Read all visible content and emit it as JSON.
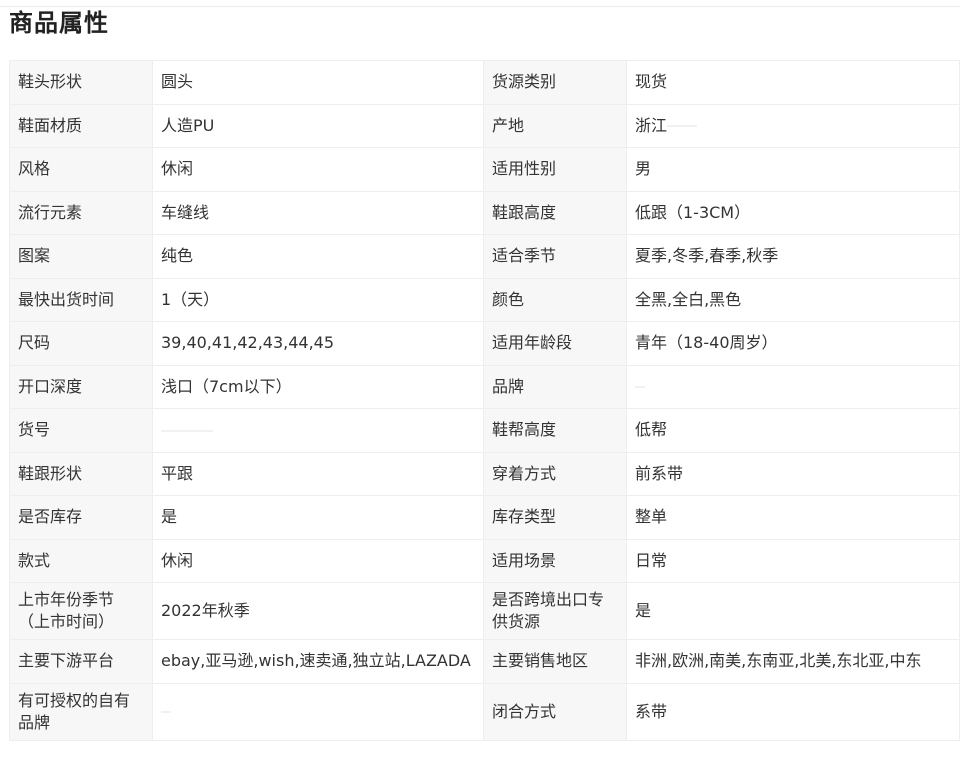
{
  "section_title": "商品属性",
  "rows": [
    {
      "k1": "鞋头形状",
      "v1": "圆头",
      "k2": "货源类别",
      "v2": "现货"
    },
    {
      "k1": "鞋面材质",
      "v1": "人造PU",
      "k2": "产地",
      "v2": "浙江"
    },
    {
      "k1": "风格",
      "v1": "休闲",
      "k2": "适用性别",
      "v2": "男"
    },
    {
      "k1": "流行元素",
      "v1": "车缝线",
      "k2": "鞋跟高度",
      "v2": "低跟（1-3CM）"
    },
    {
      "k1": "图案",
      "v1": "纯色",
      "k2": "适合季节",
      "v2": "夏季,冬季,春季,秋季"
    },
    {
      "k1": "最快出货时间",
      "v1": "1（天）",
      "k2": "颜色",
      "v2": "全黑,全白,黑色"
    },
    {
      "k1": "尺码",
      "v1": "39,40,41,42,43,44,45",
      "k2": "适用年龄段",
      "v2": "青年（18-40周岁）"
    },
    {
      "k1": "开口深度",
      "v1": "浅口（7cm以下）",
      "k2": "品牌",
      "v2": ""
    },
    {
      "k1": "货号",
      "v1": "",
      "k2": "鞋帮高度",
      "v2": "低帮"
    },
    {
      "k1": "鞋跟形状",
      "v1": "平跟",
      "k2": "穿着方式",
      "v2": "前系带"
    },
    {
      "k1": "是否库存",
      "v1": "是",
      "k2": "库存类型",
      "v2": "整单"
    },
    {
      "k1": "款式",
      "v1": "休闲",
      "k2": "适用场景",
      "v2": "日常"
    },
    {
      "k1": "上市年份季节（上市时间）",
      "v1": "2022年秋季",
      "k2": "是否跨境出口专供货源",
      "v2": "是"
    },
    {
      "k1": "主要下游平台",
      "v1": "ebay,亚马逊,wish,速卖通,独立站,LAZADA",
      "k2": "主要销售地区",
      "v2": "非洲,欧洲,南美,东南亚,北美,东北亚,中东"
    },
    {
      "k1": "有可授权的自有品牌",
      "v1": "",
      "k2": "闭合方式",
      "v2": "系带"
    }
  ]
}
